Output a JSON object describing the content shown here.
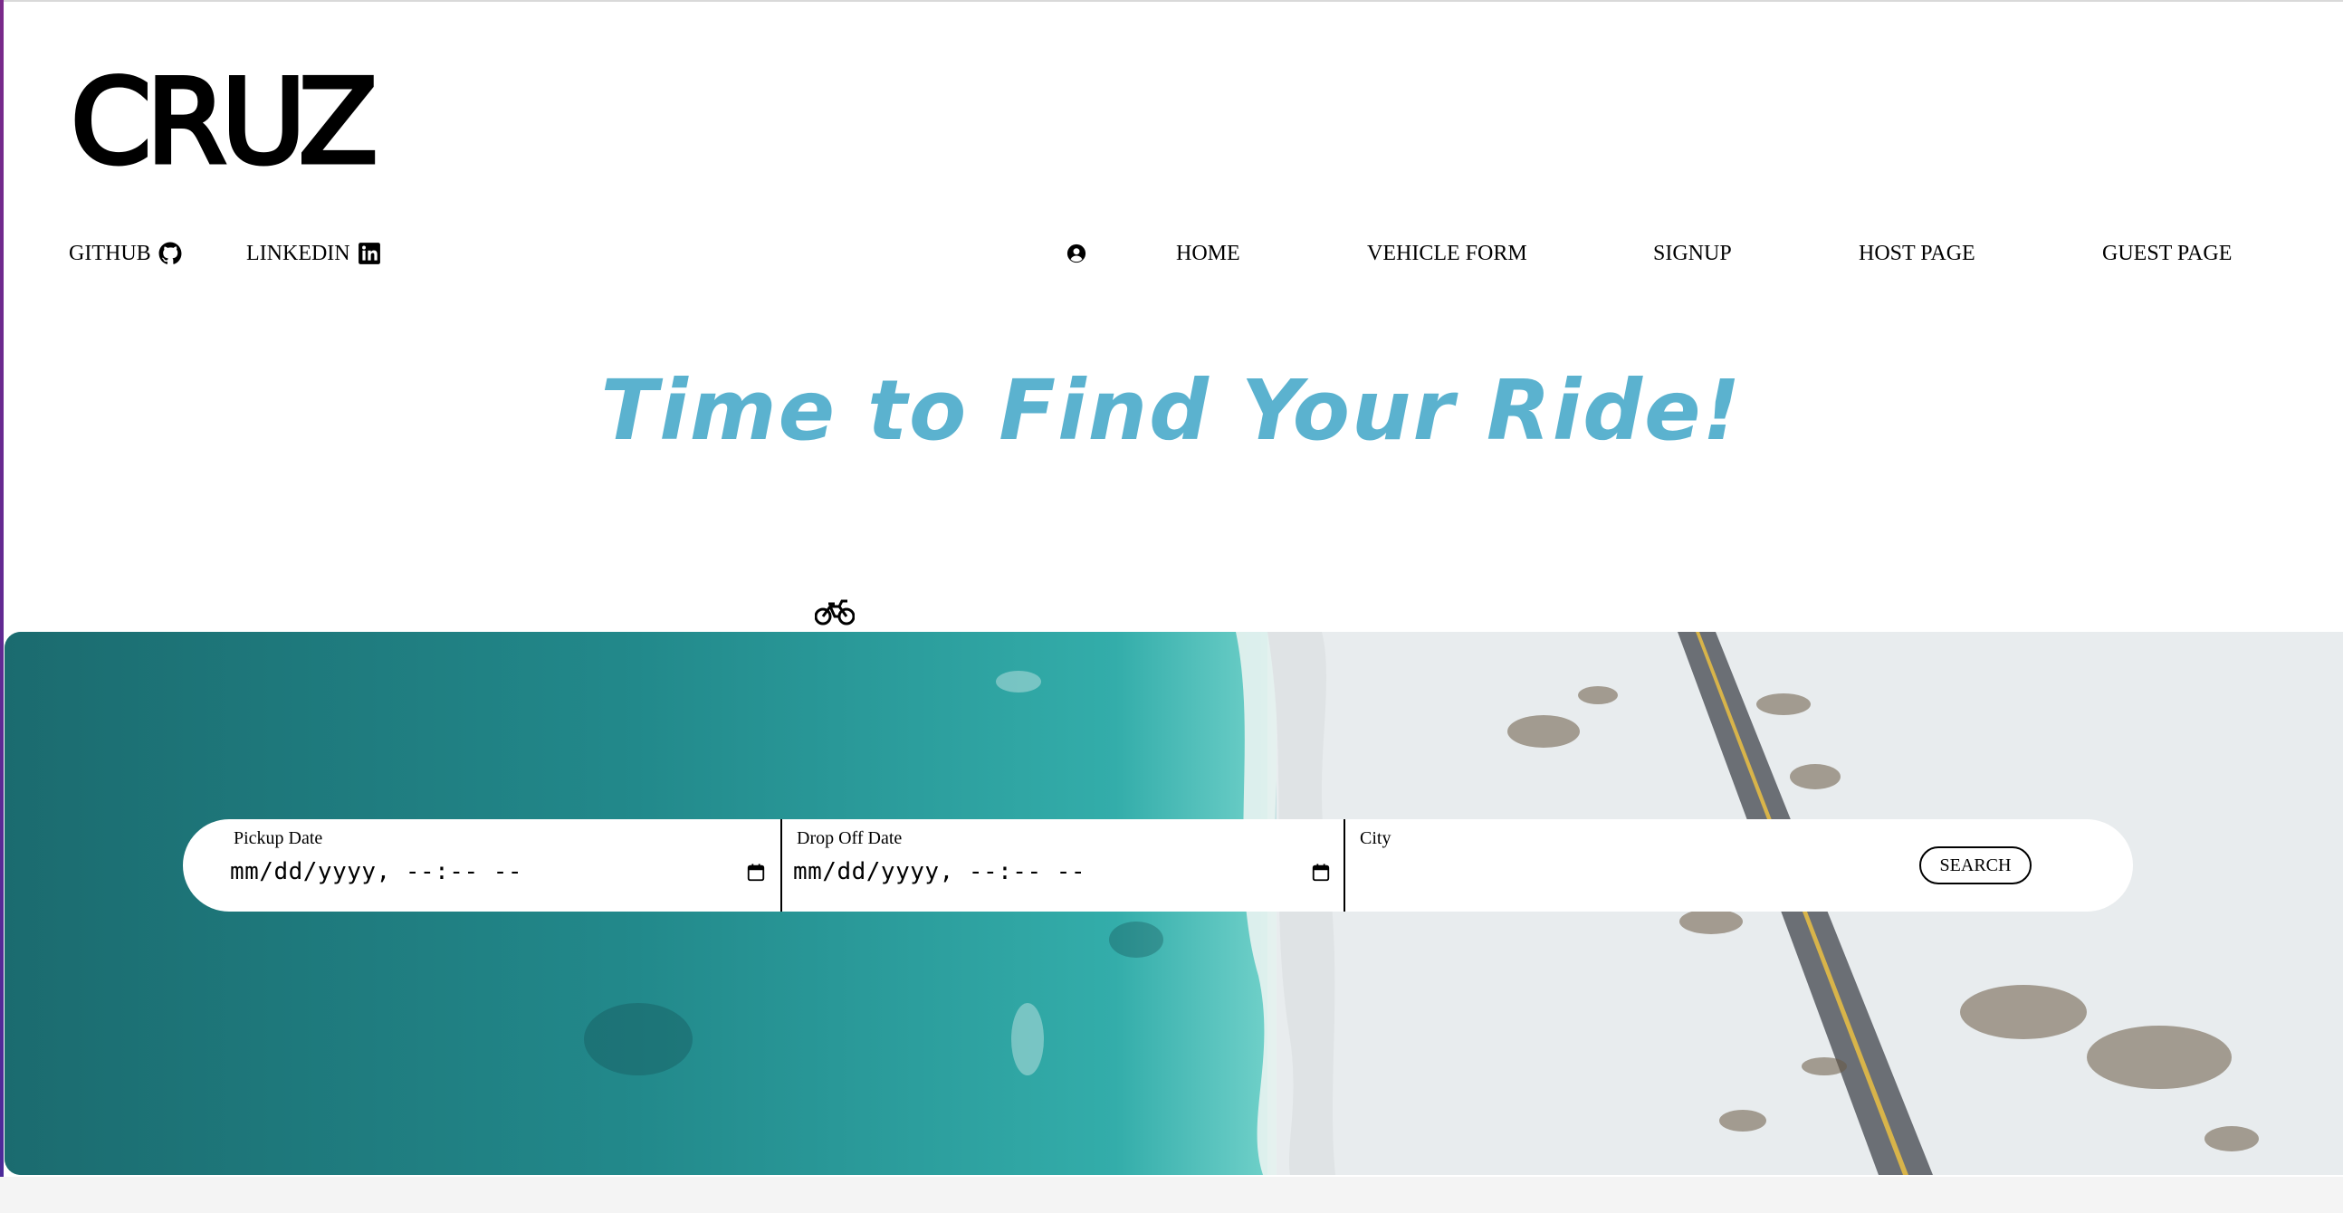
{
  "brand": {
    "logo_text": "CRUZ"
  },
  "nav": {
    "left": [
      {
        "label": "GITHUB",
        "icon": "github-icon"
      },
      {
        "label": "LINKEDIN",
        "icon": "linkedin-icon"
      }
    ],
    "profile_icon": "user-circle-icon",
    "right": [
      {
        "label": "HOME"
      },
      {
        "label": "VEHICLE FORM"
      },
      {
        "label": "SIGNUP"
      },
      {
        "label": "HOST PAGE"
      },
      {
        "label": "GUEST PAGE"
      }
    ]
  },
  "hero": {
    "headline": "Time to Find Your Ride!",
    "bike_icon": "motorcycle-icon",
    "colors": {
      "headline": "#5bb2cf",
      "sea": "#238a8a",
      "sand": "#e7ecef"
    }
  },
  "search": {
    "pickup_label": "Pickup Date",
    "pickup_value": "mm/dd/yyyy, --:-- --",
    "dropoff_label": "Drop Off Date",
    "dropoff_value": "mm/dd/yyyy, --:-- --",
    "city_label": "City",
    "city_value": "",
    "button_label": "SEARCH"
  }
}
